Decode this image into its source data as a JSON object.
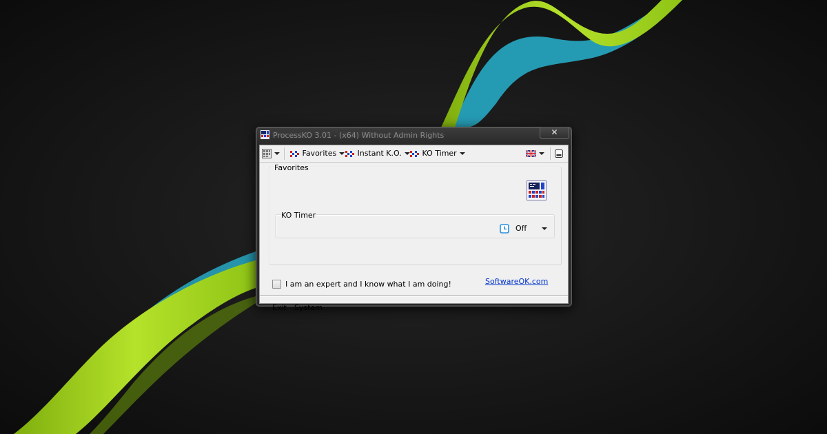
{
  "window": {
    "title": "ProcessKO 3.01 - (x64) Without Admin Rights",
    "close_label": "✕"
  },
  "toolbar": {
    "favorites_label": "Favorites",
    "instant_ko_label": "Instant K.O.",
    "ko_timer_label": "KO Timer"
  },
  "favorites_group": {
    "label": "Favorites"
  },
  "ko_timer_group": {
    "label": "KO Timer",
    "timer_value": "Off"
  },
  "expert_checkbox": {
    "label": "I am an expert and I know what I am doing!",
    "checked": false
  },
  "link": {
    "label": "SoftwareOK.com"
  },
  "bottom_menu": {
    "exit_label": "Exit",
    "system_label": "System"
  },
  "colors": {
    "wallpaper": "#141414",
    "swoosh_green": "#a6d61b",
    "swoosh_cyan": "#2bb5cf",
    "link": "#0033cc",
    "dialog_bg": "#f0f0f0"
  }
}
